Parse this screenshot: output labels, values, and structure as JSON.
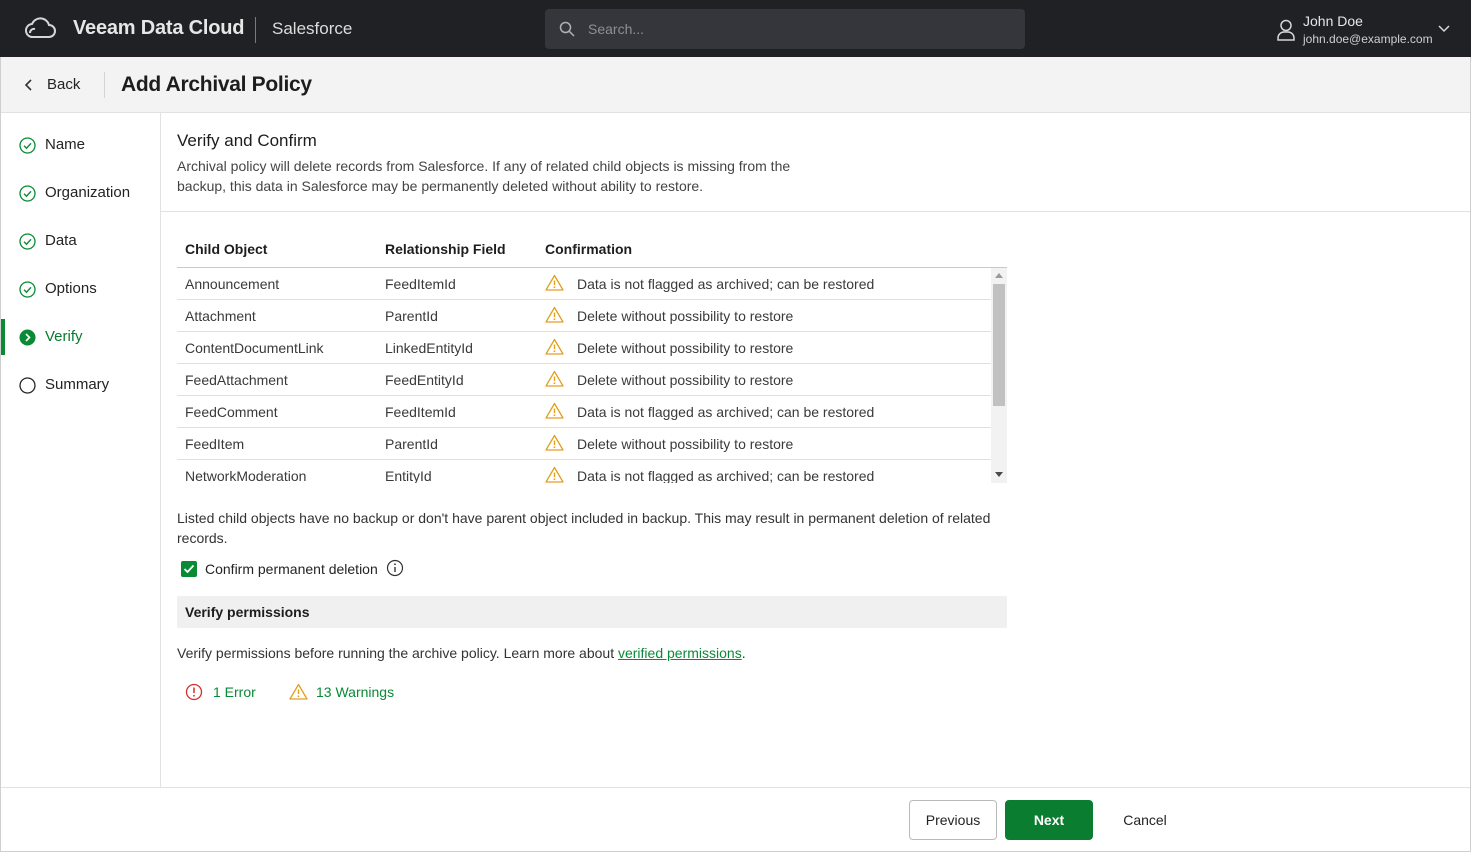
{
  "app": {
    "brand": "Veeam Data Cloud",
    "product": "Salesforce",
    "search_placeholder": "Search...",
    "user": {
      "name": "John Doe",
      "email": "john.doe@example.com"
    }
  },
  "header": {
    "back_label": "Back",
    "title": "Add Archival Policy"
  },
  "steps": [
    {
      "label": "Name",
      "state": "done"
    },
    {
      "label": "Organization",
      "state": "done"
    },
    {
      "label": "Data",
      "state": "done"
    },
    {
      "label": "Options",
      "state": "done"
    },
    {
      "label": "Verify",
      "state": "active"
    },
    {
      "label": "Summary",
      "state": "pending"
    }
  ],
  "main": {
    "title": "Verify and Confirm",
    "description": "Archival policy will delete records from Salesforce. If any of related child objects is missing from the backup, this data in Salesforce may be permanently deleted without ability to restore.",
    "table": {
      "columns": [
        "Child Object",
        "Relationship Field",
        "Confirmation"
      ],
      "rows": [
        {
          "child": "Announcement",
          "field": "FeedItemId",
          "confirmation": "Data is not flagged as archived; can be restored"
        },
        {
          "child": "Attachment",
          "field": "ParentId",
          "confirmation": "Delete without possibility to restore"
        },
        {
          "child": "ContentDocumentLink",
          "field": "LinkedEntityId",
          "confirmation": "Delete without possibility to restore"
        },
        {
          "child": "FeedAttachment",
          "field": "FeedEntityId",
          "confirmation": "Delete without possibility to restore"
        },
        {
          "child": "FeedComment",
          "field": "FeedItemId",
          "confirmation": "Data is not flagged as archived; can be restored"
        },
        {
          "child": "FeedItem",
          "field": "ParentId",
          "confirmation": "Delete without possibility to restore"
        },
        {
          "child": "NetworkModeration",
          "field": "EntityId",
          "confirmation": "Data is not flagged as archived; can be restored"
        }
      ]
    },
    "note": "Listed child objects have no backup or don't have parent object included in backup. This may result in permanent deletion of related records.",
    "confirm_label": "Confirm permanent deletion",
    "confirm_checked": true,
    "permissions": {
      "title": "Verify permissions",
      "desc_prefix": "Verify permissions before running the archive policy. Learn more about ",
      "link_text": "verified permissions",
      "desc_suffix": ".",
      "errors_label": "1 Error",
      "warnings_label": "13 Warnings"
    }
  },
  "footer": {
    "previous": "Previous",
    "next": "Next",
    "cancel": "Cancel"
  },
  "colors": {
    "accent": "#0a8a35",
    "topbar": "#1f2125",
    "warning": "#e0a020",
    "error": "#d92b2b"
  }
}
